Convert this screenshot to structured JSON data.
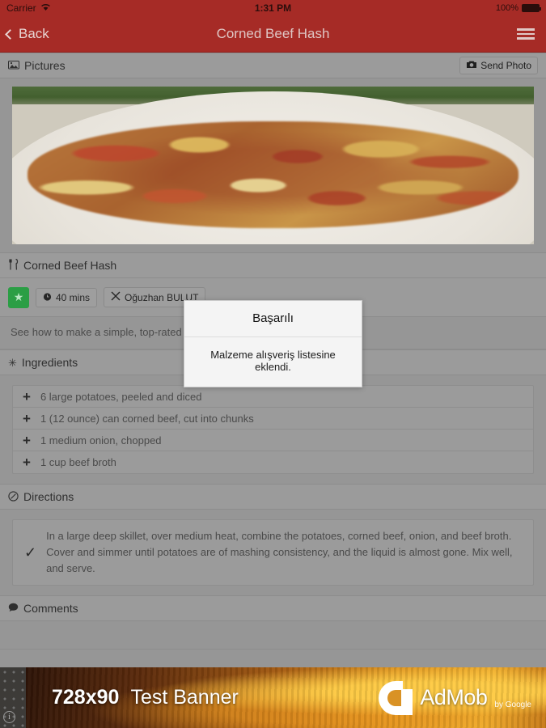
{
  "statusbar": {
    "carrier": "Carrier",
    "wifi_icon": "wifi-icon",
    "time": "1:31 PM",
    "battery_pct": "100%"
  },
  "navbar": {
    "back_label": "Back",
    "title": "Corned Beef Hash",
    "menu_icon": "hamburger-menu-icon"
  },
  "pictures": {
    "header_label": "Pictures",
    "header_icon": "image-icon",
    "send_photo_label": "Send Photo",
    "send_photo_icon": "camera-icon"
  },
  "recipe": {
    "title": "Corned Beef Hash",
    "title_icon": "fork-knife-icon",
    "favorite_icon": "star-icon",
    "time_icon": "clock-icon",
    "time_label": "40 mins",
    "author_icon": "utensils-icon",
    "author_label": "Oğuzhan BULUT",
    "description": "See how to make a simple, top-rated c"
  },
  "ingredients": {
    "header_label": "Ingredients",
    "header_icon": "asterisk-icon",
    "add_icon": "plus-icon",
    "items": [
      "6 large potatoes, peeled and diced",
      "1 (12 ounce) can corned beef, cut into chunks",
      "1 medium onion, chopped",
      "1 cup beef broth"
    ]
  },
  "directions": {
    "header_label": "Directions",
    "header_icon": "clock-check-icon",
    "check_icon": "check-icon",
    "steps": [
      "In a large deep skillet, over medium heat, combine the potatoes, corned beef, onion, and beef broth. Cover and simmer until potatoes are of mashing consistency, and the liquid is almost gone. Mix well, and serve."
    ]
  },
  "comments": {
    "header_label": "Comments",
    "header_icon": "comment-icon"
  },
  "admob": {
    "size_label": "728x90",
    "banner_label": "Test Banner",
    "brand": "AdMob",
    "by_label": "by Google",
    "info_icon": "info-icon"
  },
  "dialog": {
    "title": "Başarılı",
    "message": "Malzeme alışveriş listesine eklendi."
  },
  "colors": {
    "brand_red": "#a62b26",
    "favorite_green": "#2b9e45",
    "page_bg": "#969696"
  }
}
